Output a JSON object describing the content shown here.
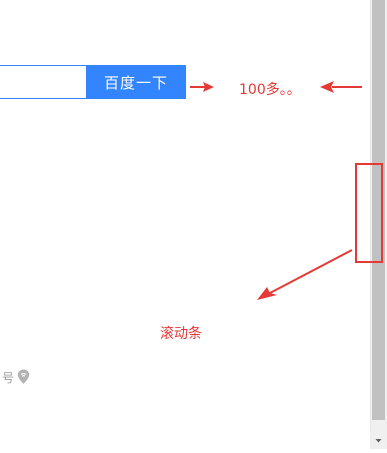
{
  "search": {
    "value": "",
    "button_label": "百度一下"
  },
  "annotations": {
    "width_note": "100多。。",
    "scrollbar_note": "滚动条",
    "color": "#e53935"
  },
  "footer": {
    "icp_fragment": "号",
    "location_icon": "location-pin-icon"
  },
  "scrollbar": {
    "thumb_color": "#c1c1c1",
    "track_color": "#f0f0f0"
  },
  "colors": {
    "accent": "#3385ff",
    "button_text": "#ffffff"
  }
}
